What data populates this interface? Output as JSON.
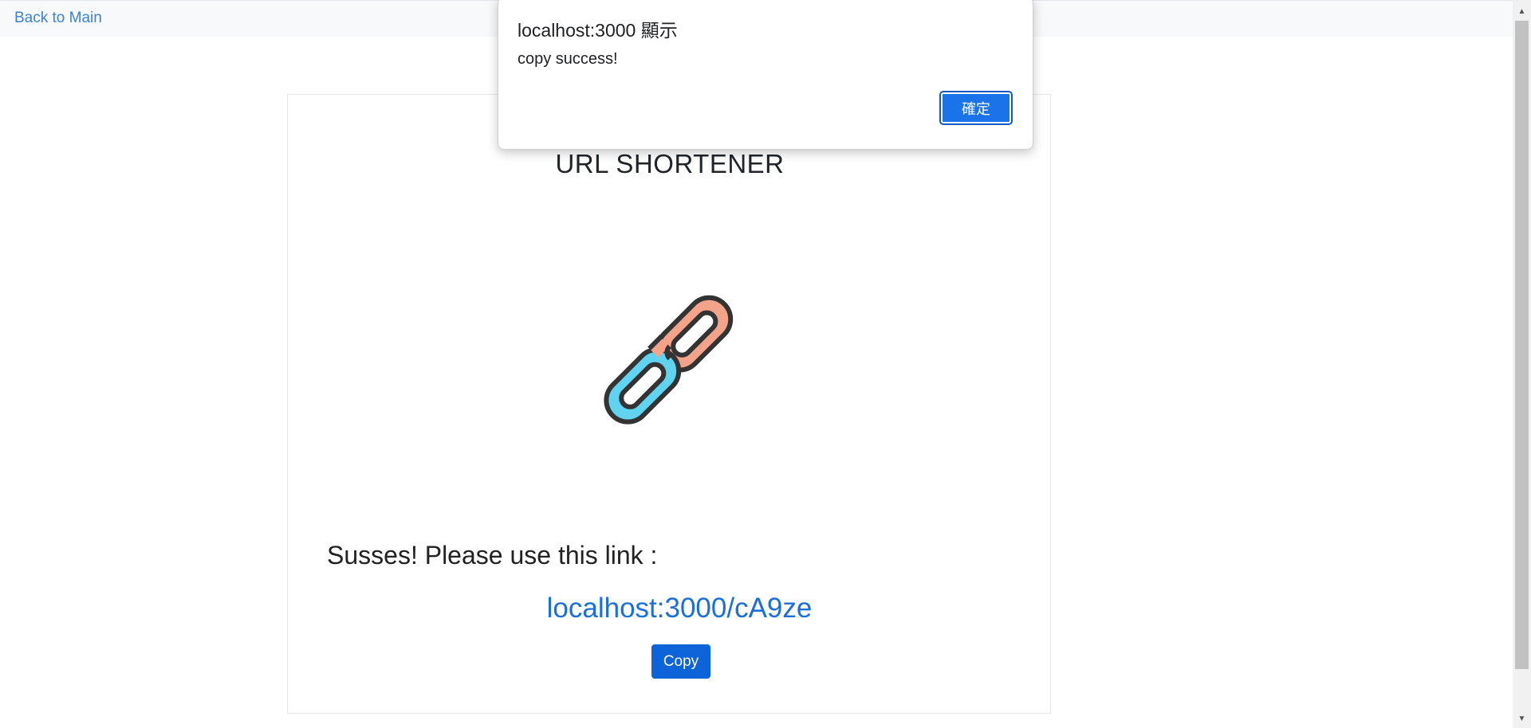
{
  "topbar": {
    "back_link": "Back to Main"
  },
  "card": {
    "title": "URL SHORTENER",
    "icon": "chain-link-icon",
    "success_message": "Susses! Please use this link :",
    "short_link": "localhost:3000/cA9ze",
    "copy_label": "Copy"
  },
  "dialog": {
    "title": "localhost:3000 顯示",
    "message": "copy success!",
    "ok_label": "確定"
  },
  "colors": {
    "link": "#1a6fd8",
    "button": "#0d63d8",
    "dialog_button": "#1a73e8",
    "chain_blue": "#5fd3f0",
    "chain_salmon": "#f3a389",
    "chain_outline": "#333333"
  }
}
